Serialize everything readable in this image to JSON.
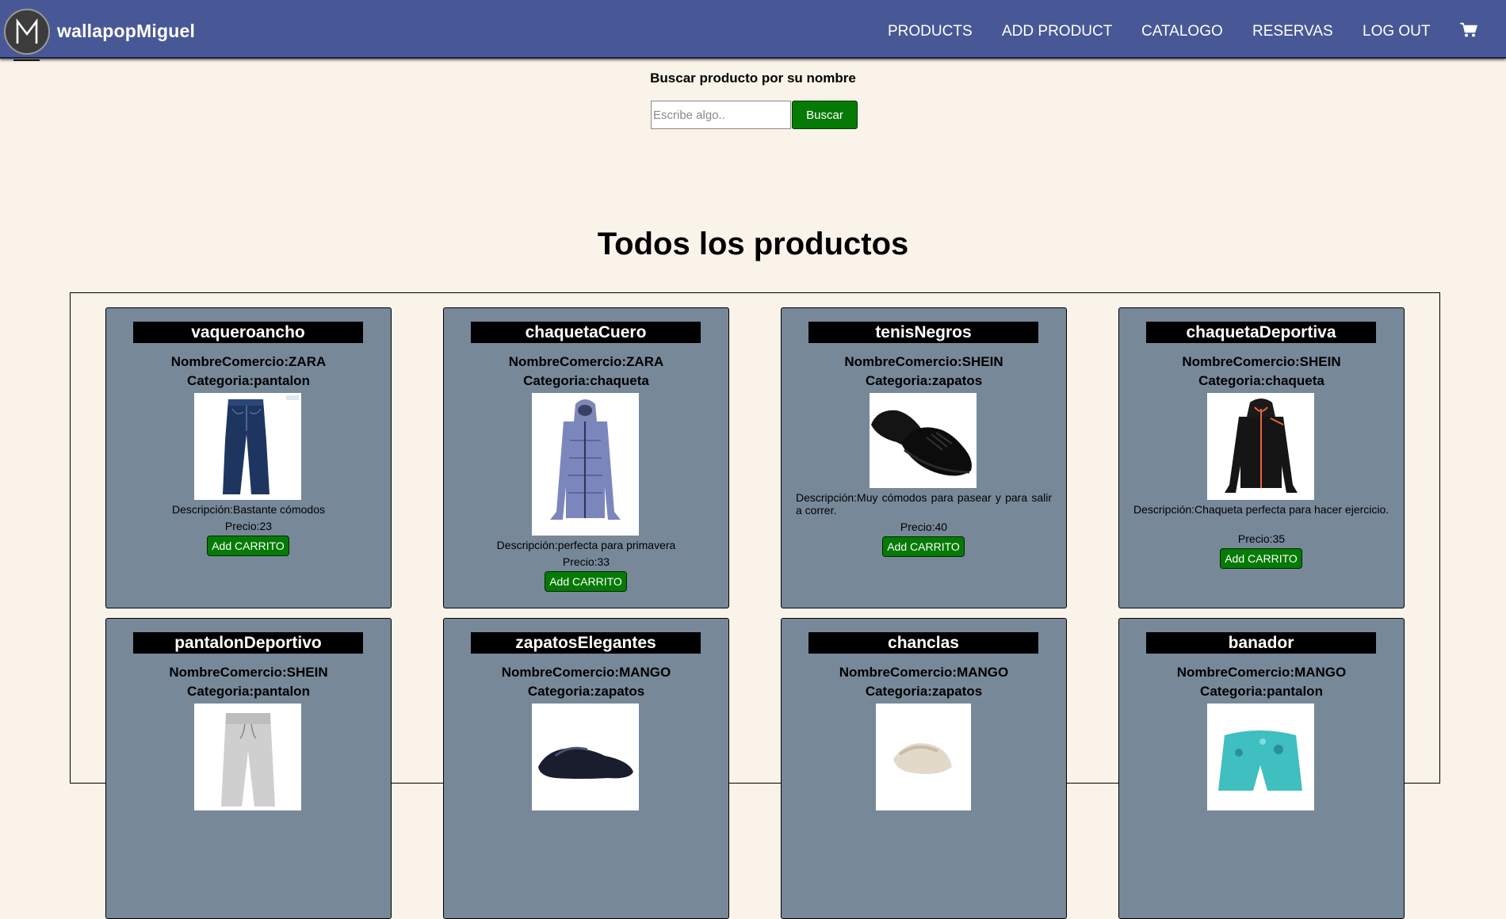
{
  "nav": {
    "brand": "wallapopMiguel",
    "links": [
      "PRODUCTS",
      "ADD PRODUCT",
      "CATALOGO",
      "RESERVAS",
      "LOG OUT"
    ],
    "cart_icon": "shopping-cart-icon"
  },
  "search": {
    "title": "Buscar producto por su nombre",
    "placeholder": "Escribe algo..",
    "button": "Buscar"
  },
  "heading": "Todos los productos",
  "products": [
    {
      "name": "vaqueroancho",
      "commerce": "NombreComercio:ZARA",
      "category": "Categoria:pantalon",
      "description": "Descripción:Bastante cómodos",
      "price": "Precio:23",
      "button": "Add CARRITO",
      "image": "jeans"
    },
    {
      "name": "chaquetaCuero",
      "commerce": "NombreComercio:ZARA",
      "category": "Categoria:chaqueta",
      "description": "Descripción:perfecta para primavera",
      "price": "Precio:33",
      "button": "Add CARRITO",
      "image": "puffer-jacket"
    },
    {
      "name": "tenisNegros",
      "commerce": "NombreComercio:SHEIN",
      "category": "Categoria:zapatos",
      "description": "Descripción:Muy cómodos para pasear y para salir a correr.",
      "price": "Precio:40",
      "button": "Add CARRITO",
      "image": "black-sneakers"
    },
    {
      "name": "chaquetaDeportiva",
      "commerce": "NombreComercio:SHEIN",
      "category": "Categoria:chaqueta",
      "description": "Descripción:Chaqueta perfecta para hacer ejercicio.",
      "price": "Precio:35",
      "button": "Add CARRITO",
      "image": "sport-jacket"
    },
    {
      "name": "pantalonDeportivo",
      "commerce": "NombreComercio:SHEIN",
      "category": "Categoria:pantalon",
      "image": "grey-joggers"
    },
    {
      "name": "zapatosElegantes",
      "commerce": "NombreComercio:MANGO",
      "category": "Categoria:zapatos",
      "image": "dress-shoes"
    },
    {
      "name": "chanclas",
      "commerce": "NombreComercio:MANGO",
      "category": "Categoria:zapatos",
      "image": "sandals"
    },
    {
      "name": "banador",
      "commerce": "NombreComercio:MANGO",
      "category": "Categoria:pantalon",
      "image": "swim-shorts"
    }
  ]
}
